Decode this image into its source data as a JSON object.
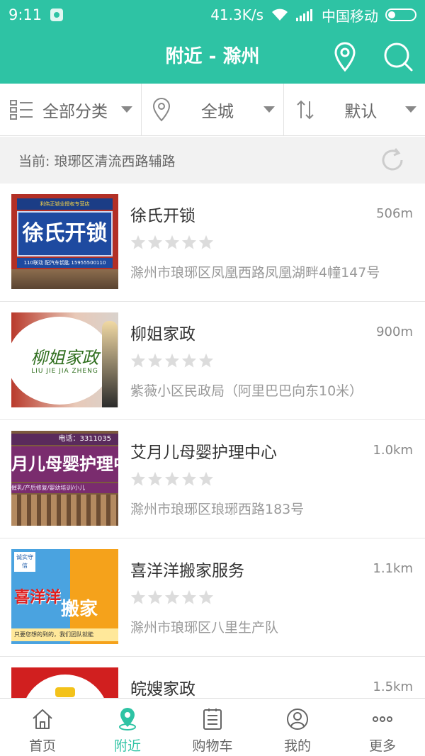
{
  "status_bar": {
    "time": "9:11",
    "network_speed": "41.3K/s",
    "carrier": "中国移动"
  },
  "header": {
    "title": "附近 - 滁州"
  },
  "filters": [
    {
      "label": "全部分类"
    },
    {
      "label": "全城"
    },
    {
      "label": "默认"
    }
  ],
  "current_location": {
    "text": "当前: 琅琊区清流西路辅路"
  },
  "listings": [
    {
      "name": "徐氏开锁",
      "distance": "506m",
      "rating": 0,
      "address": "滁州市琅琊区凤凰西路凤凰湖畔4幢147号",
      "thumb": {
        "main": "徐氏开锁",
        "small_top": "利伟正锁业授权专营店",
        "small_bottom": "110联动 配汽车钥匙 15955500110"
      }
    },
    {
      "name": "柳姐家政",
      "distance": "900m",
      "rating": 0,
      "address": "紫薇小区民政局（阿里巴巴向东10米）",
      "thumb": {
        "main": "柳姐家政",
        "sub": "LIU JIE JIA ZHENG"
      }
    },
    {
      "name": "艾月儿母婴护理中心",
      "distance": "1.0km",
      "rating": 0,
      "address": "滁州市琅琊区琅琊西路183号",
      "thumb": {
        "main": "月儿母婴护理中",
        "small_top": "电话：3311035",
        "small_bottom": "催乳/产后修复/婴幼培训/小儿"
      }
    },
    {
      "name": "喜洋洋搬家服务",
      "distance": "1.1km",
      "rating": 0,
      "address": "滁州市琅琊区八里生产队",
      "thumb": {
        "main": "喜洋洋",
        "main2": "搬家",
        "small_top": "诚实守信",
        "small_bottom": "只要您想的到的，我们团队就能"
      }
    },
    {
      "name": "皖嫂家政",
      "distance": "1.5km",
      "rating": 0,
      "address": "",
      "thumb": {}
    }
  ],
  "tabbar": [
    {
      "label": "首页",
      "icon": "home-icon",
      "active": false
    },
    {
      "label": "附近",
      "icon": "location-pin-icon",
      "active": true
    },
    {
      "label": "购物车",
      "icon": "cart-clipboard-icon",
      "active": false
    },
    {
      "label": "我的",
      "icon": "user-icon",
      "active": false
    },
    {
      "label": "更多",
      "icon": "more-dots-icon",
      "active": false
    }
  ],
  "colors": {
    "brand": "#2ec3a4",
    "star_empty": "#dcdcdc"
  }
}
